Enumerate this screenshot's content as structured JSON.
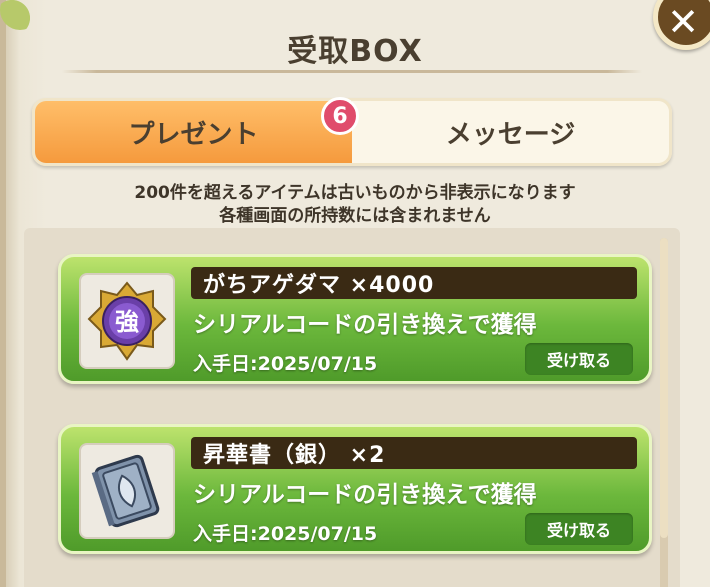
{
  "header": {
    "title": "受取BOX",
    "close_icon": "close-icon"
  },
  "tabs": [
    {
      "label": "プレゼント",
      "active": true
    },
    {
      "label": "メッセージ",
      "active": false
    }
  ],
  "badge": {
    "count": "6"
  },
  "notice": {
    "line1": "200件を超えるアイテムは古いものから非表示になります",
    "line2": "各種画面の所持数には含まれません"
  },
  "items": [
    {
      "name": "がちアゲダマ ×4000",
      "description": "シリアルコードの引き換えで獲得",
      "date": "入手日:2025/07/15",
      "button_label": "受け取る",
      "icon": "medal-icon",
      "icon_text": "強"
    },
    {
      "name": "昇華書（銀） ×2",
      "description": "シリアルコードの引き換えで獲得",
      "date": "入手日:2025/07/15",
      "button_label": "受け取る",
      "icon": "book-icon"
    }
  ],
  "colors": {
    "tab_active": "#f59a3d",
    "card_green": "#6cb83c",
    "badge": "#e04c6c",
    "name_bar": "#3a2a14"
  }
}
